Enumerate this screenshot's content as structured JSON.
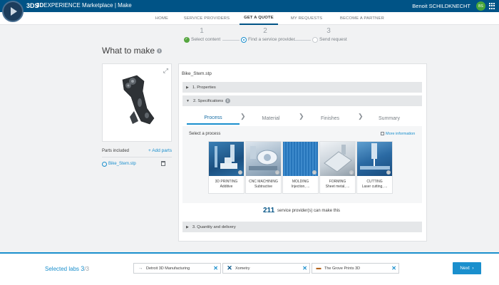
{
  "header": {
    "brand_mark": "3DS",
    "app_title_bold": "3D",
    "app_title_rest": "EXPERIENCE Marketplace | Make",
    "user_name": "Benoit SCHILDKNECHT",
    "user_initials": "BS"
  },
  "nav": {
    "tabs": [
      {
        "label": "HOME"
      },
      {
        "label": "SERVICE PROVIDERS"
      },
      {
        "label": "GET A QUOTE"
      },
      {
        "label": "MY REQUESTS"
      },
      {
        "label": "BECOME A PARTNER"
      }
    ],
    "active_tab": "GET A QUOTE"
  },
  "stepper": {
    "steps": [
      {
        "number": "1",
        "label": "Select content",
        "state": "done"
      },
      {
        "number": "2",
        "label": "Find a service provider",
        "state": "current"
      },
      {
        "number": "3",
        "label": "Send request",
        "state": "pending"
      }
    ]
  },
  "page": {
    "title": "What to make",
    "info_glyph": "i"
  },
  "parts": {
    "title": "Parts included",
    "add_label": "+ Add parts",
    "items": [
      {
        "name": "Bike_Stem.stp"
      }
    ]
  },
  "config": {
    "file_name": "Bike_Stem.stp",
    "sections": [
      {
        "label": "1. Properties",
        "expanded": false
      },
      {
        "label": "2. Specifications",
        "expanded": true
      },
      {
        "label": "3. Quantity and delivery",
        "expanded": false
      }
    ],
    "spec_tabs": [
      {
        "label": "Process"
      },
      {
        "label": "Material"
      },
      {
        "label": "Finishes"
      },
      {
        "label": "Summary"
      }
    ],
    "active_spec_tab": "Process",
    "select_label": "Select a process",
    "more_info": "More information",
    "processes": [
      {
        "name": "3D PRINTING",
        "sub": "Additive"
      },
      {
        "name": "CNC MACHINING",
        "sub": "Subtractive"
      },
      {
        "name": "MOLDING",
        "sub": "Injection, ..."
      },
      {
        "name": "FORMING",
        "sub": "Sheet metal, ..."
      },
      {
        "name": "CUTTING",
        "sub": "Laser cutting, ..."
      }
    ],
    "provider_count": "211",
    "provider_text": "service provider(s) can make this"
  },
  "footer": {
    "selected_label": "Selected labs",
    "selected_count": "3",
    "selected_total": "/3",
    "labs": [
      {
        "name": "Detroit 3D Manufacturing",
        "logo": "→"
      },
      {
        "name": "Xometry",
        "logo": "✕"
      },
      {
        "name": "The Grove Prints 3D",
        "logo": "▬"
      }
    ],
    "remove_glyph": "✕",
    "next_label": "Next",
    "next_icon": "›"
  },
  "icons": {
    "expand": "⤢",
    "section_collapsed": "▶",
    "section_expanded": "▼",
    "tab_chevron": "❯"
  },
  "colors": {
    "brand_blue": "#005386",
    "accent_blue": "#1a8fcd",
    "success_green": "#56a63f"
  }
}
